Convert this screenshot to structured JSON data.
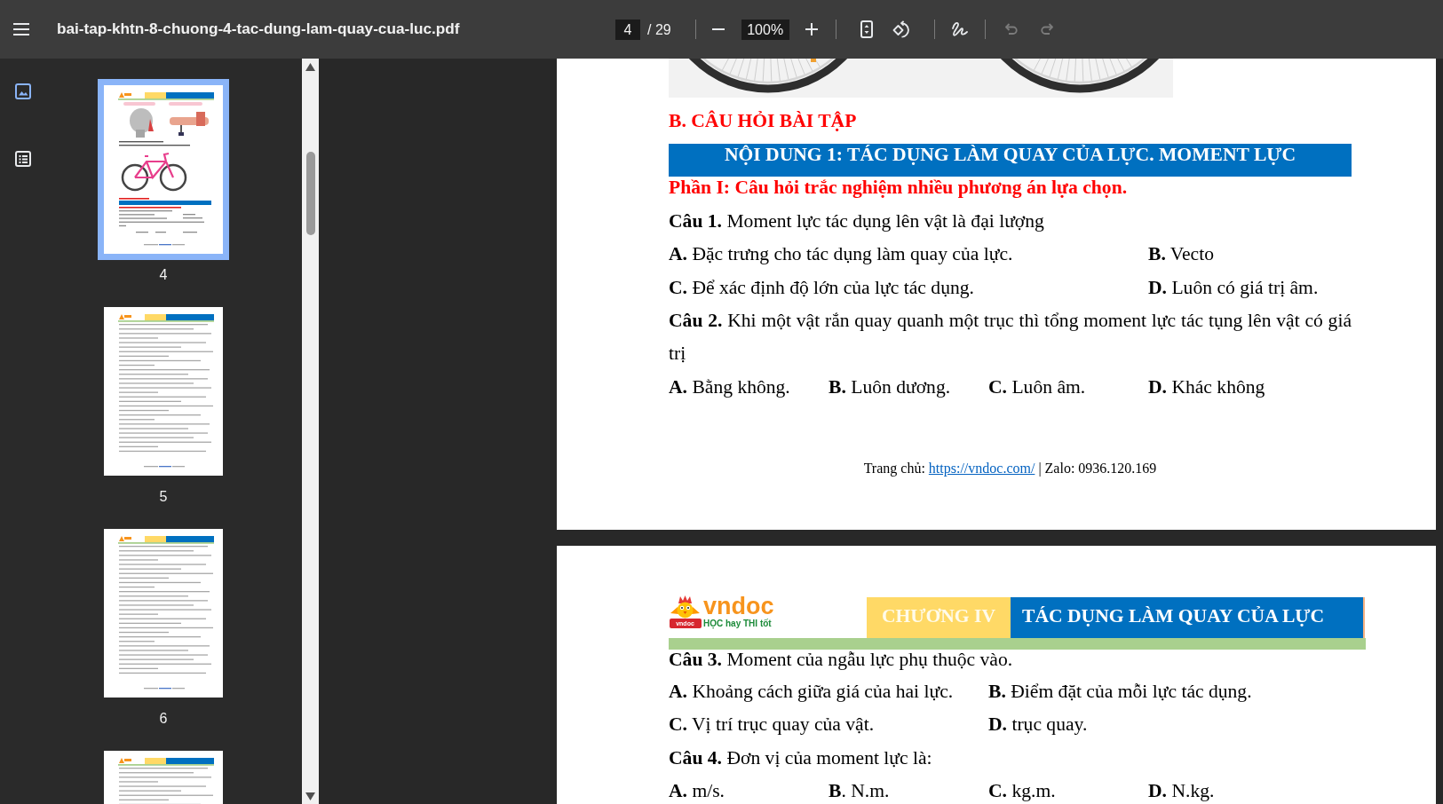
{
  "toolbar": {
    "title": "bai-tap-khtn-8-chuong-4-tac-dung-lam-quay-cua-luc.pdf",
    "page": "4",
    "page_count": "/ 29",
    "zoom": "100%",
    "undo": {
      "disabled": true
    },
    "redo": {
      "disabled": true
    }
  },
  "sidebar": {
    "tabs": [
      {
        "kind": "thumbnails",
        "selected": true
      },
      {
        "kind": "outline",
        "selected": false
      }
    ],
    "thumbnails": [
      {
        "kind": "illustrated",
        "label": "4",
        "selected": true
      },
      {
        "kind": "text",
        "label": "5",
        "selected": false
      },
      {
        "kind": "text",
        "label": "6",
        "selected": false
      },
      {
        "kind": "text",
        "selected": false
      }
    ]
  },
  "document": {
    "pages": [
      {
        "blocks": [
          {
            "kind": "photo"
          },
          {
            "kind": "heading",
            "text": "B. CÂU HỎI BÀI TẬP"
          },
          {
            "kind": "banner",
            "text": "NỘI DUNG 1: TÁC DỤNG LÀM QUAY CỦA LỰC. MOMENT LỰC"
          },
          {
            "kind": "subheading",
            "text": "Phần I: Câu hỏi trắc nghiệm nhiều phương án lựa chọn."
          },
          {
            "kind": "question",
            "text": "**Câu 1.** Moment lực tác dụng lên vật là đại lượng"
          },
          {
            "kind": "options",
            "rows": [
              [
                "**A.** Đặc trưng cho tác dụng làm quay của lực.",
                "**B.** Vecto"
              ],
              [
                "**C.** Để xác định độ lớn của lực tác dụng.",
                "**D.** Luôn có giá trị âm."
              ]
            ]
          },
          {
            "kind": "question",
            "text": "**Câu 2.** Khi một vật rắn quay quanh một trục thì tổng moment lực tác tụng lên vật có giá trị"
          },
          {
            "kind": "options",
            "rows": [
              [
                "**A.** Bằng không.",
                "**B.** Luôn dương.",
                "**C.** Luôn âm.",
                "**D.** Khác không"
              ]
            ]
          }
        ],
        "footer": {
          "prefix": "Trang chủ:",
          "link": "https://vndoc.com/",
          "suffix": "| Zalo: 0936.120.169"
        }
      },
      {
        "header": {
          "logo": {
            "wordmark": "vndoc",
            "tagline": "HỌC hay THI tốt",
            "ribbon": "vndoc"
          },
          "chapter": "CHƯƠNG IV",
          "title": "TÁC DỤNG LÀM QUAY CỦA LỰC"
        },
        "blocks": [
          {
            "kind": "question",
            "text": "**Câu 3.** Moment của ngẫu lực phụ thuộc vào."
          },
          {
            "kind": "options",
            "rows": [
              [
                "**A.** Khoảng cách giữa giá của hai lực.",
                "**B.** Điểm đặt của mỗi lực tác dụng."
              ],
              [
                "**C.** Vị trí trục quay của vật.",
                "**D.** trục quay."
              ]
            ]
          },
          {
            "kind": "question",
            "text": "**Câu 4.** Đơn vị của moment lực là:"
          },
          {
            "kind": "options",
            "rows": [
              [
                "**A.** m/s.",
                "**B**. N.m.",
                "**C.** kg.m.",
                "**D.** N.kg."
              ]
            ]
          }
        ]
      }
    ]
  }
}
